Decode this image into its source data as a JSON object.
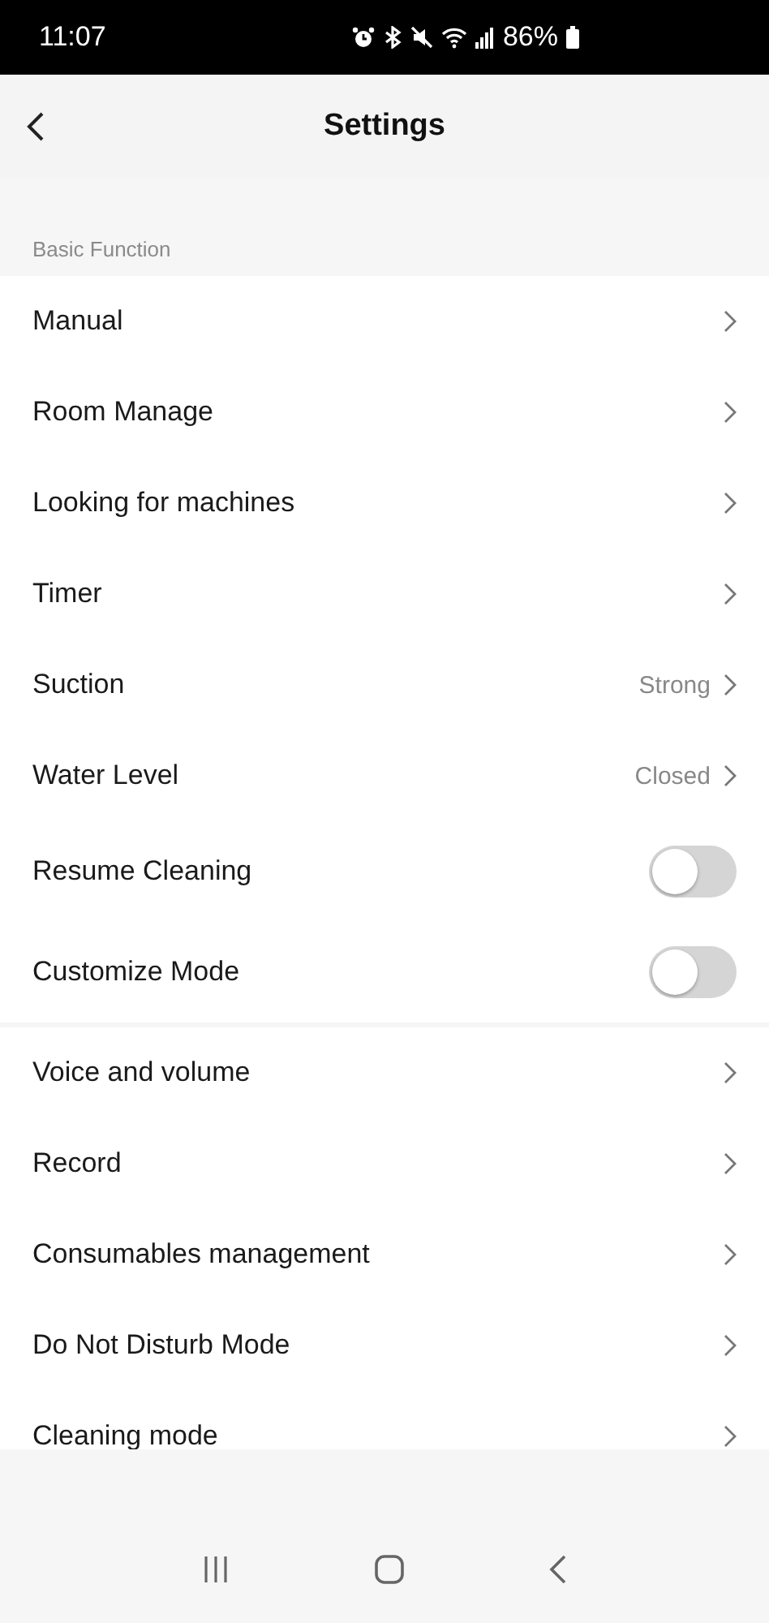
{
  "status_bar": {
    "time": "11:07",
    "battery": "86%"
  },
  "header": {
    "title": "Settings"
  },
  "section": {
    "label": "Basic Function"
  },
  "groups": [
    {
      "items": [
        {
          "label": "Manual",
          "kind": "link"
        },
        {
          "label": "Room Manage",
          "kind": "link"
        },
        {
          "label": "Looking for machines",
          "kind": "link"
        },
        {
          "label": "Timer",
          "kind": "link"
        },
        {
          "label": "Suction",
          "kind": "link",
          "value": "Strong"
        },
        {
          "label": "Water Level",
          "kind": "link",
          "value": "Closed"
        },
        {
          "label": "Resume Cleaning",
          "kind": "toggle",
          "on": false
        },
        {
          "label": "Customize Mode",
          "kind": "toggle",
          "on": false
        }
      ]
    },
    {
      "items": [
        {
          "label": "Voice and volume",
          "kind": "link"
        },
        {
          "label": "Record",
          "kind": "link"
        },
        {
          "label": "Consumables management",
          "kind": "link"
        },
        {
          "label": "Do Not Disturb Mode",
          "kind": "link"
        },
        {
          "label": "Cleaning mode",
          "kind": "link"
        }
      ]
    }
  ]
}
